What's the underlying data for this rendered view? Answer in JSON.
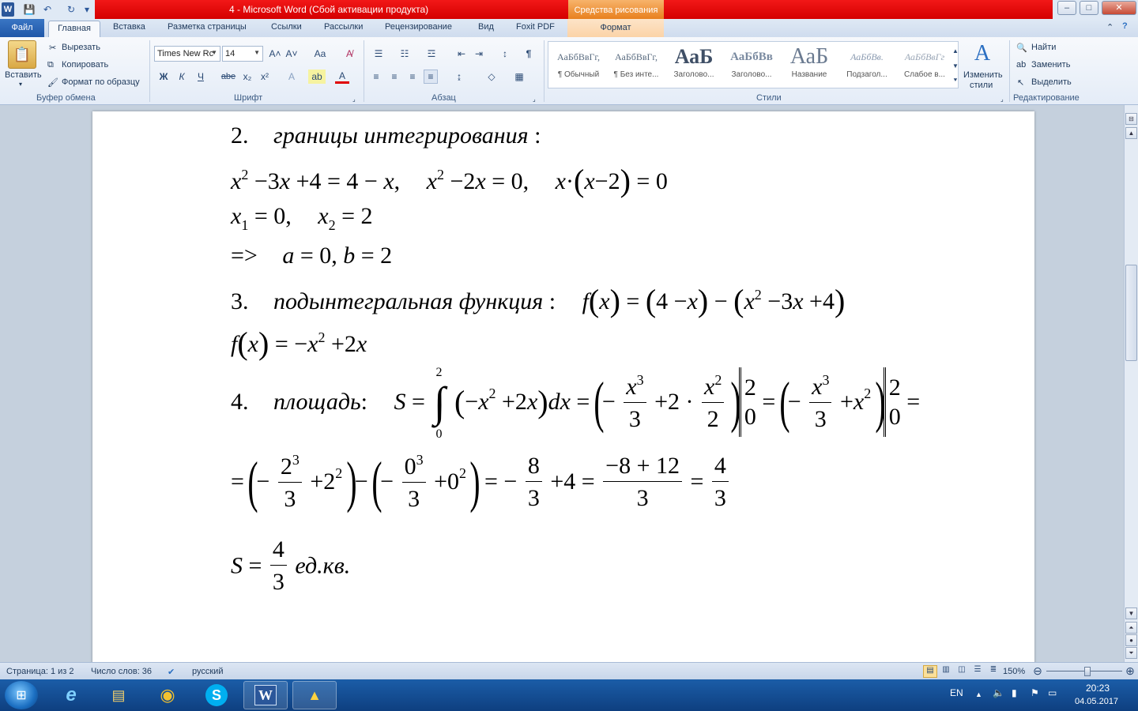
{
  "window": {
    "title": "4  -  Microsoft Word (Сбой активации продукта)",
    "context_tab": "Средства рисования",
    "qat": {
      "word_icon": "W",
      "save_icon": "💾",
      "undo_icon": "↶",
      "redo_icon": "↻",
      "customize_icon": "▾"
    },
    "controls": {
      "minimize": "–",
      "maximize": "□",
      "close": "✕"
    }
  },
  "tabs": {
    "file": "Файл",
    "home": "Главная",
    "insert": "Вставка",
    "layout": "Разметка страницы",
    "references": "Ссылки",
    "mailings": "Рассылки",
    "review": "Рецензирование",
    "view": "Вид",
    "foxit": "Foxit PDF",
    "format": "Формат"
  },
  "ribbon": {
    "clipboard": {
      "paste": "Вставить",
      "cut": "Вырезать",
      "copy": "Копировать",
      "format_painter": "Формат по образцу",
      "label": "Буфер обмена"
    },
    "font": {
      "name": "Times New Rc",
      "size": "14",
      "grow": "A˄",
      "shrink": "A˅",
      "change_case": "Aa",
      "clear": "A̸",
      "bold": "Ж",
      "italic": "К",
      "underline": "Ч",
      "strike": "abe",
      "subscript": "x₂",
      "superscript": "x²",
      "effects": "A",
      "highlight": "ab",
      "color": "A",
      "label": "Шрифт"
    },
    "paragraph": {
      "bullets": "☰",
      "numbering": "☷",
      "multilevel": "☲",
      "outdent": "⇤",
      "indent": "⇥",
      "sort": "↕",
      "pilcrow": "¶",
      "align_left": "≡",
      "center": "≡",
      "align_right": "≡",
      "justify": "≡",
      "spacing": "↨",
      "shading": "◇",
      "borders": "▦",
      "label": "Абзац"
    },
    "styles": {
      "items": [
        {
          "sample": "АаБбВвГг,",
          "name": "¶ Обычный"
        },
        {
          "sample": "АаБбВвГг,",
          "name": "¶ Без инте..."
        },
        {
          "sample": "АаБ",
          "name": "Заголово..."
        },
        {
          "sample": "АаБбВв",
          "name": "Заголово..."
        },
        {
          "sample": "АаБ",
          "name": "Название"
        },
        {
          "sample": "АаБбВв.",
          "name": "Подзагол..."
        },
        {
          "sample": "АаБбВвГг",
          "name": "Слабое в..."
        }
      ],
      "change_line1": "Изменить",
      "change_line2": "стили",
      "label": "Стили"
    },
    "editing": {
      "find": "Найти",
      "replace": "Заменить",
      "select": "Выделить",
      "label": "Редактирование"
    }
  },
  "document": {
    "line2": {
      "num": "2.",
      "text": "границы интегрирования",
      "colon": ":"
    },
    "eq1": {
      "x": "x",
      "two": "2",
      "rest1": "−3",
      "x2": "x",
      "rest2": "+4 = 4 −",
      "x3": "x",
      "comma": ",",
      "xb": "x",
      "twob": "2",
      "rest3": "−2",
      "xc": "x",
      "rest4": "= 0,",
      "xd": "x",
      "dot": "·",
      "xe": "x",
      "rest5": "−2",
      "rest6": "= 0"
    },
    "roots": {
      "x1": "x",
      "s1": "1",
      "v1": "= 0,",
      "x2": "x",
      "s2": "2",
      "v2": "= 2"
    },
    "limits": {
      "arrow": "=>",
      "a": "a",
      "v": "= 0,",
      "b": "b",
      "v2": "= 2"
    },
    "line3": {
      "num": "3.",
      "text": "подынтегральная функция",
      "colon": ":",
      "f": "f",
      "x": "x",
      "eq": "=",
      "four": "4 −",
      "x2": "x",
      "minus": "−",
      "x3": "x",
      "two": "2",
      "rest": "−3",
      "x4": "x",
      "plus4": "+4"
    },
    "fx": {
      "f": "f",
      "x": "x",
      "eq": "= −",
      "x2": "x",
      "two": "2",
      "rest": "+2",
      "x3": "x"
    },
    "line4": {
      "num": "4.",
      "text": "площадь",
      "colon": ":",
      "S": "S",
      "eq": "=",
      "int_up": "2",
      "int_lo": "0",
      "int": "∫",
      "minus": "−",
      "x": "x",
      "two": "2",
      "plus2": "+2",
      "x2": "x",
      "dx": "dx",
      "eq2": "=",
      "fr1_num_x": "x",
      "fr1_num_p": "3",
      "fr1_den": "3",
      "plus": "+2 ·",
      "fr2_num_x": "x",
      "fr2_num_p": "2",
      "fr2_den": "2",
      "lim_up": "2",
      "lim_lo": "0",
      "eq3": "=",
      "fr3_num_x": "x",
      "fr3_num_p": "3",
      "fr3_den": "3",
      "plus3": "+",
      "x3": "x",
      "p3": "2",
      "lim_up2": "2",
      "lim_lo2": "0",
      "eq4": "="
    },
    "line5": {
      "eq": "=",
      "minus": "−",
      "f1n": "2",
      "f1p": "3",
      "f1d": "3",
      "plus1": "+2",
      "p1": "2",
      "mid": "−",
      "minus2": "−",
      "f2n": "0",
      "f2p": "3",
      "f2d": "3",
      "plus2": "+0",
      "p2": "2",
      "eq2": "= −",
      "f3n": "8",
      "f3d": "3",
      "plus4": "+4 =",
      "f4n": "−8 + 12",
      "f4d": "3",
      "eq3": "=",
      "f5n": "4",
      "f5d": "3"
    },
    "answer": {
      "S": "S",
      "eq": "=",
      "n": "4",
      "d": "3",
      "unit": "ед.кв."
    }
  },
  "statusbar": {
    "page": "Страница: 1 из 2",
    "words": "Число слов: 36",
    "lang": "русский",
    "zoom": "150%"
  },
  "taskbar": {
    "apps": [
      {
        "name": "internet-explorer",
        "glyph": "e"
      },
      {
        "name": "explorer",
        "glyph": "▤"
      },
      {
        "name": "chrome",
        "glyph": "◉"
      },
      {
        "name": "skype",
        "glyph": "S"
      },
      {
        "name": "word",
        "glyph": "W"
      },
      {
        "name": "app",
        "glyph": "▲"
      }
    ],
    "lang": "EN",
    "time": "20:23",
    "date": "04.05.2017"
  }
}
